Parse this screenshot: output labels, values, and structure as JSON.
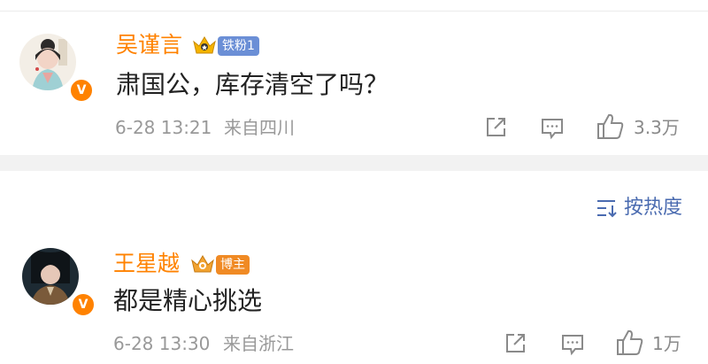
{
  "comments": [
    {
      "username": "吴谨言",
      "tag": "铁粉1",
      "verified_mark": "V",
      "text": "肃国公，库存清空了吗？",
      "time": "6-28 13:21",
      "location": "来自四川",
      "likes": "3.3万",
      "icons": [
        "share-icon",
        "comment-icon",
        "like-icon"
      ]
    },
    {
      "username": "王星越",
      "tag": "博主",
      "verified_mark": "V",
      "text": "都是精心挑选",
      "time": "6-28 13:30",
      "location": "来自浙江",
      "likes": "1万",
      "icons": [
        "share-icon",
        "comment-icon",
        "like-icon"
      ]
    }
  ],
  "sort": {
    "label": "按热度",
    "icon": "sort-icon"
  },
  "colors": {
    "username": "#ff8200",
    "verified": "#ff8200",
    "sort": "#4a6bb0",
    "tag_fan": "#6b8fd6",
    "tag_blogger": "#f08a24"
  }
}
